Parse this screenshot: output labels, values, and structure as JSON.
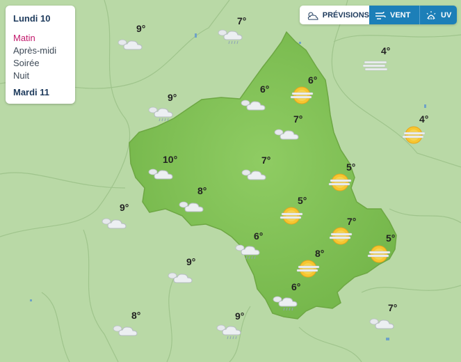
{
  "panel": {
    "day1": "Lundi 10",
    "slots": [
      "Matin",
      "Après-midi",
      "Soirée",
      "Nuit"
    ],
    "active_slot": "Matin",
    "day2": "Mardi 11"
  },
  "tabs": {
    "previsions": "PRÉVISIONS",
    "vent": "VENT",
    "uv": "UV"
  },
  "colors": {
    "accent": "#c2186b",
    "tab_blue": "#1c7fb8",
    "region": "#84c35a"
  },
  "temps": [
    {
      "t": "9°",
      "icon": "cloud-icon"
    },
    {
      "t": "7°",
      "icon": "cloud-rain-icon"
    },
    {
      "t": "4°",
      "icon": "fog-icon"
    },
    {
      "t": "6°",
      "icon": "sun-fog-icon"
    },
    {
      "t": "6°",
      "icon": "cloud-icon"
    },
    {
      "t": "9°",
      "icon": "cloud-rain-icon"
    },
    {
      "t": "7°",
      "icon": "cloud-icon"
    },
    {
      "t": "4°",
      "icon": "sun-fog-icon"
    },
    {
      "t": "10°",
      "icon": "cloud-icon"
    },
    {
      "t": "7°",
      "icon": "cloud-icon"
    },
    {
      "t": "5°",
      "icon": "sun-fog-icon"
    },
    {
      "t": "8°",
      "icon": "cloud-icon"
    },
    {
      "t": "9°",
      "icon": "cloud-icon"
    },
    {
      "t": "5°",
      "icon": "sun-fog-icon"
    },
    {
      "t": "7°",
      "icon": "sun-fog-icon"
    },
    {
      "t": "6°",
      "icon": "cloud-rain-icon"
    },
    {
      "t": "5°",
      "icon": "sun-fog-icon"
    },
    {
      "t": "8°",
      "icon": "sun-fog-icon"
    },
    {
      "t": "9°",
      "icon": "cloud-icon"
    },
    {
      "t": "6°",
      "icon": "cloud-rain-icon"
    },
    {
      "t": "7°",
      "icon": "cloud-icon"
    },
    {
      "t": "8°",
      "icon": "cloud-icon"
    },
    {
      "t": "9°",
      "icon": "cloud-rain-icon"
    }
  ]
}
